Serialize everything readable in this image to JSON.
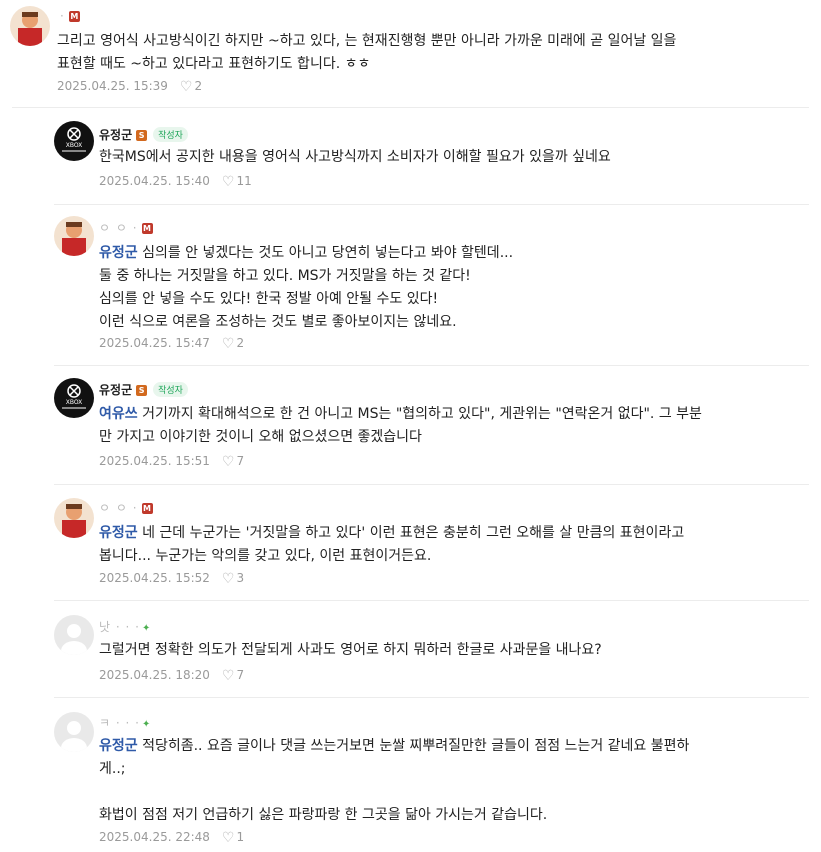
{
  "comments": [
    {
      "nick": "·",
      "badge": "M",
      "body": "그리고 영어식 사고방식이긴 하지만 ~하고 있다, 는 현재진행형 뿐만 아니라 가까운 미래에 곧 일어날 일을\n표현할 때도 ~하고 있다라고 표현하기도 합니다. ㅎㅎ",
      "date": "2025.04.25. 15:39",
      "likes": "2"
    },
    {
      "nick": "유정군",
      "badge": "S",
      "author_tag": "작성자",
      "body": "한국MS에서 공지한 내용을 영어식 사고방식까지 소비자가 이해할 필요가 있을까 싶네요",
      "date": "2025.04.25. 15:40",
      "likes": "11"
    },
    {
      "nick": "ㅇ ㅇ ·",
      "badge": "M",
      "mention": "유정군",
      "body": " 심의를 안 넣겠다는 것도 아니고 당연히 넣는다고 봐야 할텐데...\n둘 중 하나는 거짓말을 하고 있다. MS가 거짓말을 하는 것 같다!\n심의를 안 넣을 수도 있다! 한국 정발 아예 안될 수도 있다!\n이런 식으로 여론을 조성하는 것도 별로 좋아보이지는 않네요.",
      "date": "2025.04.25. 15:47",
      "likes": "2"
    },
    {
      "nick": "유정군",
      "badge": "S",
      "author_tag": "작성자",
      "mention": "여유쓰",
      "body": " 거기까지 확대해석으로 한 건 아니고 MS는 \"협의하고 있다\", 게관위는 \"연락온거 없다\". 그 부분\n만 가지고 이야기한 것이니 오해 없으셨으면 좋겠습니다",
      "date": "2025.04.25. 15:51",
      "likes": "7"
    },
    {
      "nick": "ㅇ ㅇ ·",
      "badge": "M",
      "mention": "유정군",
      "body": " 네 근데 누군가는 '거짓말을 하고 있다' 이런 표현은 충분히 그런 오해를 살 만큼의 표현이라고\n봅니다... 누군가는 악의를 갖고 있다, 이런 표현이거든요.",
      "date": "2025.04.25. 15:52",
      "likes": "3"
    },
    {
      "nick": "낫 · · ·",
      "sprout": "✦",
      "body": "그럴거면 정확한 의도가 전달되게 사과도 영어로 하지 뭐하러 한글로 사과문을 내나요?",
      "date": "2025.04.25. 18:20",
      "likes": "7"
    },
    {
      "nick": "ㅋ · · ·",
      "sprout": "✦",
      "mention": "유정군",
      "body": " 적당히좀.. 요즘 글이나 댓글 쓰는거보면 눈쌀 찌뿌려질만한 글들이 점점 느는거 같네요 불편하\n게..;\n\n화법이 점점 저기 언급하기 싫은 파랑파랑 한 그곳을 닮아 가시는거 같습니다.",
      "date": "2025.04.25. 22:48",
      "likes": "1"
    }
  ],
  "colors": {
    "mention": "#2f5aa8",
    "author_tag": "#1fa65a",
    "meta": "#9a9a9a"
  },
  "icons": {
    "like": "heart-outline-icon",
    "sprout": "sprout-icon"
  }
}
